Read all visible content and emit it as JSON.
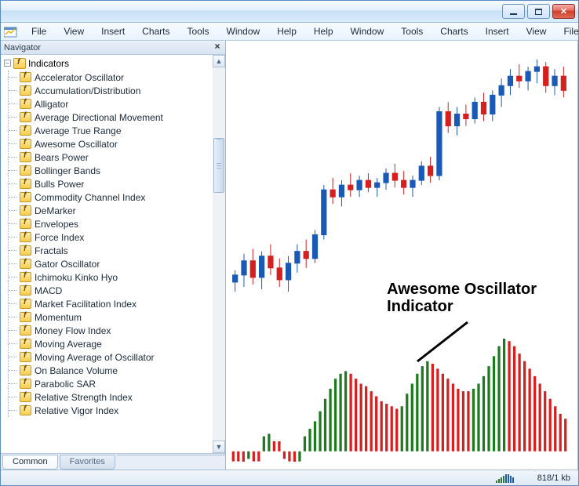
{
  "menu": {
    "items": [
      "File",
      "View",
      "Insert",
      "Charts",
      "Tools",
      "Window",
      "Help"
    ]
  },
  "navigator": {
    "title": "Navigator",
    "root": "Indicators",
    "items": [
      "Accelerator Oscillator",
      "Accumulation/Distribution",
      "Alligator",
      "Average Directional Movement",
      "Average True Range",
      "Awesome Oscillator",
      "Bears Power",
      "Bollinger Bands",
      "Bulls Power",
      "Commodity Channel Index",
      "DeMarker",
      "Envelopes",
      "Force Index",
      "Fractals",
      "Gator Oscillator",
      "Ichimoku Kinko Hyo",
      "MACD",
      "Market Facilitation Index",
      "Momentum",
      "Money Flow Index",
      "Moving Average",
      "Moving Average of Oscillator",
      "On Balance Volume",
      "Parabolic SAR",
      "Relative Strength Index",
      "Relative Vigor Index"
    ],
    "tabs": {
      "active": "Common",
      "inactive": "Favorites"
    }
  },
  "annotation": {
    "line1": "Awesome Oscillator",
    "line2": "Indicator"
  },
  "status": {
    "traffic": "818/1 kb"
  },
  "colors": {
    "up": "#1e7a1e",
    "down": "#d61f1f",
    "blue": "#1b59b6"
  },
  "chart_data": {
    "type": "candlestick+histogram",
    "candles": {
      "note": "open/high/low/close estimated from pixels on an arbitrary scale 0-100 (bottom of candle pane = 0, top = 100)",
      "series": [
        {
          "o": 4,
          "h": 9,
          "l": 0,
          "c": 7,
          "color": "up"
        },
        {
          "o": 7,
          "h": 16,
          "l": 2,
          "c": 13,
          "color": "up"
        },
        {
          "o": 13,
          "h": 18,
          "l": 3,
          "c": 6,
          "color": "down"
        },
        {
          "o": 6,
          "h": 17,
          "l": 1,
          "c": 15,
          "color": "up"
        },
        {
          "o": 15,
          "h": 20,
          "l": 7,
          "c": 10,
          "color": "down"
        },
        {
          "o": 10,
          "h": 14,
          "l": 2,
          "c": 5,
          "color": "down"
        },
        {
          "o": 5,
          "h": 15,
          "l": 0,
          "c": 12,
          "color": "up"
        },
        {
          "o": 12,
          "h": 20,
          "l": 8,
          "c": 17,
          "color": "up"
        },
        {
          "o": 17,
          "h": 22,
          "l": 10,
          "c": 14,
          "color": "down"
        },
        {
          "o": 14,
          "h": 26,
          "l": 12,
          "c": 24,
          "color": "up"
        },
        {
          "o": 24,
          "h": 45,
          "l": 22,
          "c": 43,
          "color": "up"
        },
        {
          "o": 43,
          "h": 48,
          "l": 37,
          "c": 40,
          "color": "down"
        },
        {
          "o": 40,
          "h": 47,
          "l": 36,
          "c": 45,
          "color": "up"
        },
        {
          "o": 45,
          "h": 50,
          "l": 40,
          "c": 43,
          "color": "down"
        },
        {
          "o": 43,
          "h": 49,
          "l": 40,
          "c": 47,
          "color": "up"
        },
        {
          "o": 47,
          "h": 50,
          "l": 42,
          "c": 44,
          "color": "down"
        },
        {
          "o": 44,
          "h": 48,
          "l": 40,
          "c": 46,
          "color": "up"
        },
        {
          "o": 46,
          "h": 52,
          "l": 43,
          "c": 50,
          "color": "up"
        },
        {
          "o": 50,
          "h": 54,
          "l": 44,
          "c": 47,
          "color": "down"
        },
        {
          "o": 47,
          "h": 51,
          "l": 41,
          "c": 44,
          "color": "down"
        },
        {
          "o": 44,
          "h": 49,
          "l": 40,
          "c": 47,
          "color": "up"
        },
        {
          "o": 47,
          "h": 55,
          "l": 45,
          "c": 53,
          "color": "up"
        },
        {
          "o": 53,
          "h": 57,
          "l": 46,
          "c": 49,
          "color": "down"
        },
        {
          "o": 49,
          "h": 78,
          "l": 47,
          "c": 76,
          "color": "up"
        },
        {
          "o": 76,
          "h": 80,
          "l": 67,
          "c": 70,
          "color": "down"
        },
        {
          "o": 70,
          "h": 78,
          "l": 66,
          "c": 75,
          "color": "up"
        },
        {
          "o": 75,
          "h": 79,
          "l": 70,
          "c": 73,
          "color": "down"
        },
        {
          "o": 73,
          "h": 82,
          "l": 71,
          "c": 80,
          "color": "up"
        },
        {
          "o": 80,
          "h": 84,
          "l": 72,
          "c": 75,
          "color": "down"
        },
        {
          "o": 75,
          "h": 85,
          "l": 72,
          "c": 83,
          "color": "up"
        },
        {
          "o": 83,
          "h": 90,
          "l": 78,
          "c": 87,
          "color": "up"
        },
        {
          "o": 87,
          "h": 94,
          "l": 83,
          "c": 91,
          "color": "up"
        },
        {
          "o": 91,
          "h": 96,
          "l": 86,
          "c": 89,
          "color": "down"
        },
        {
          "o": 89,
          "h": 95,
          "l": 85,
          "c": 93,
          "color": "up"
        },
        {
          "o": 93,
          "h": 98,
          "l": 88,
          "c": 95,
          "color": "up"
        },
        {
          "o": 95,
          "h": 97,
          "l": 84,
          "c": 87,
          "color": "down"
        },
        {
          "o": 87,
          "h": 94,
          "l": 83,
          "c": 91,
          "color": "up"
        },
        {
          "o": 91,
          "h": 95,
          "l": 82,
          "c": 85,
          "color": "down"
        }
      ]
    },
    "awesome_oscillator": {
      "note": "bar values on arbitrary scale; sign and color captured. color green=increasing vs prev bar, red=decreasing",
      "values": [
        -4,
        -4,
        -5,
        -3,
        -4,
        -4,
        6,
        7,
        4,
        4,
        -3,
        -4,
        -5,
        -4,
        6,
        9,
        12,
        16,
        21,
        25,
        29,
        31,
        32,
        31,
        29,
        27,
        26,
        24,
        22,
        20,
        19,
        18,
        17,
        18,
        23,
        27,
        31,
        34,
        36,
        35,
        33,
        31,
        29,
        27,
        25,
        24,
        24,
        25,
        27,
        30,
        34,
        38,
        42,
        45,
        44,
        42,
        39,
        36,
        33,
        30,
        27,
        24,
        21,
        18,
        15,
        13
      ],
      "colors": [
        "down",
        "down",
        "down",
        "up",
        "down",
        "down",
        "up",
        "up",
        "down",
        "down",
        "down",
        "down",
        "down",
        "up",
        "up",
        "up",
        "up",
        "up",
        "up",
        "up",
        "up",
        "up",
        "up",
        "down",
        "down",
        "down",
        "down",
        "down",
        "down",
        "down",
        "down",
        "down",
        "down",
        "up",
        "up",
        "up",
        "up",
        "up",
        "up",
        "down",
        "down",
        "down",
        "down",
        "down",
        "down",
        "down",
        "down",
        "up",
        "up",
        "up",
        "up",
        "up",
        "up",
        "up",
        "down",
        "down",
        "down",
        "down",
        "down",
        "down",
        "down",
        "down",
        "down",
        "down",
        "down",
        "down"
      ]
    }
  }
}
